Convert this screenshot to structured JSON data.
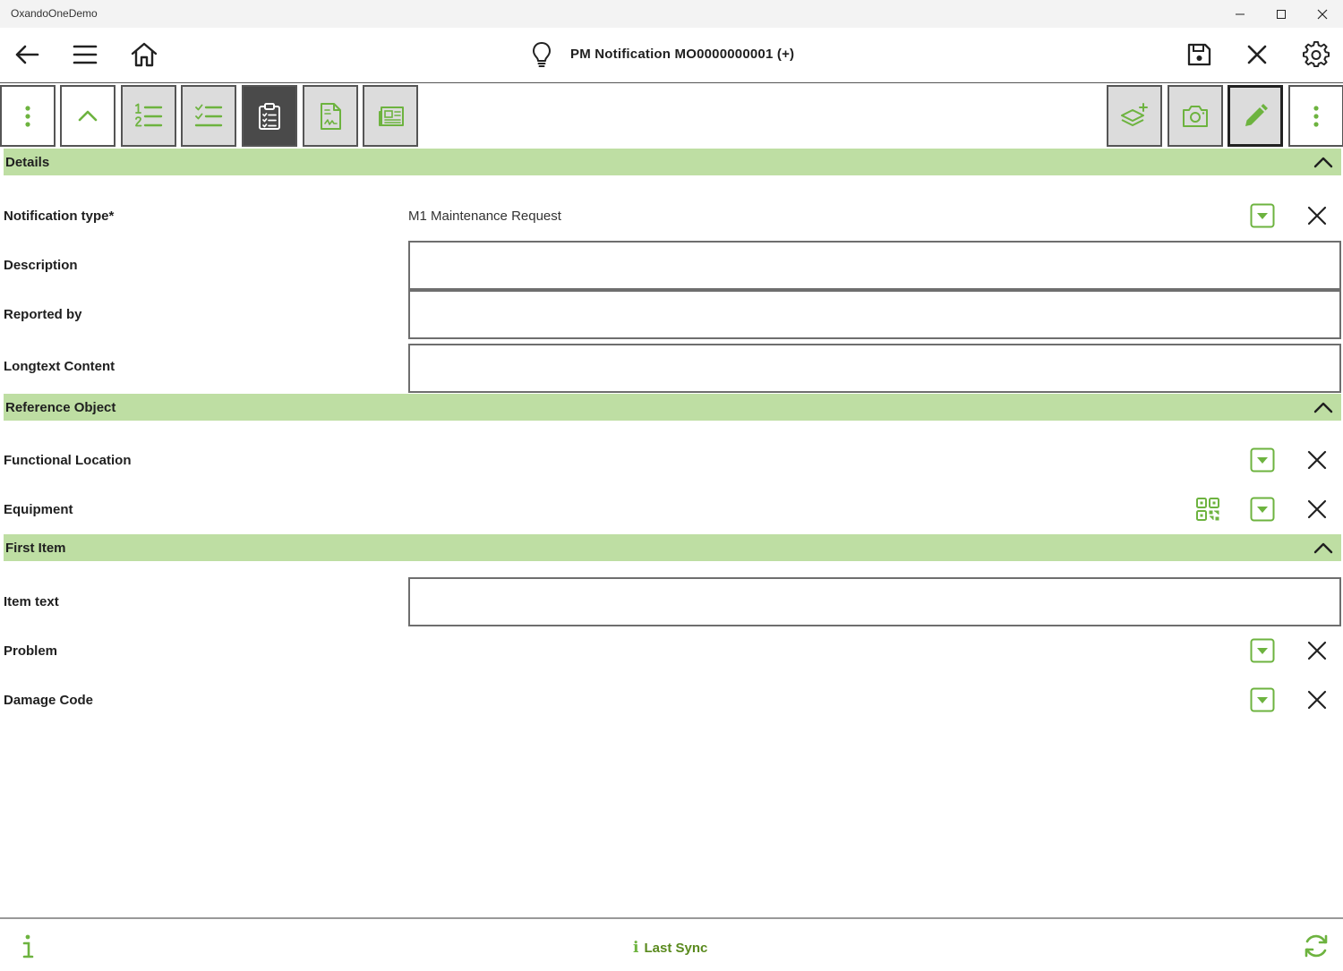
{
  "window": {
    "title": "OxandoOneDemo"
  },
  "header": {
    "title": "PM Notification MO0000000001 (+)"
  },
  "sections": {
    "details": {
      "label": "Details",
      "notification_type_label": "Notification type*",
      "notification_type_value": "M1 Maintenance Request",
      "description_label": "Description",
      "description_value": "",
      "reported_by_label": "Reported by",
      "reported_by_value": "",
      "longtext_label": "Longtext Content",
      "longtext_value": ""
    },
    "reference_object": {
      "label": "Reference Object",
      "functional_location_label": "Functional Location",
      "equipment_label": "Equipment"
    },
    "first_item": {
      "label": "First Item",
      "item_text_label": "Item text",
      "item_text_value": "",
      "problem_label": "Problem",
      "damage_code_label": "Damage Code"
    }
  },
  "footer": {
    "sync_label": "Last Sync"
  },
  "colors": {
    "accent": "#6db33f",
    "section_bg": "#bedea3",
    "dark_button": "#4a4a4a"
  }
}
